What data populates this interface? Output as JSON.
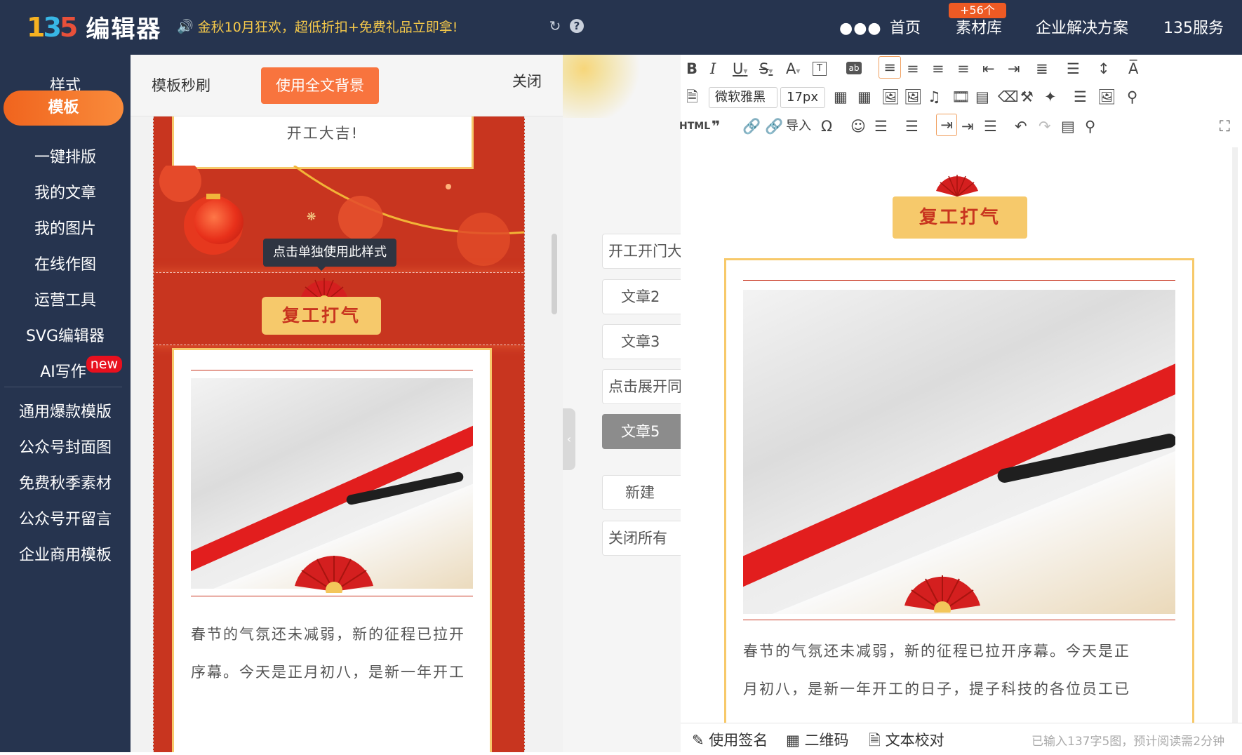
{
  "topbar": {
    "logo_mark": "135",
    "logo_text": "编辑器",
    "promo": "金秋10月狂欢，超低折扣+免费礼品立即拿!",
    "icons": [
      "refresh-icon",
      "help-icon",
      "more-icon"
    ],
    "nav": [
      "首页",
      "素材库",
      "企业解决方案",
      "135服务"
    ],
    "material_badge": "+56个"
  },
  "sidebar": {
    "items": [
      "样式",
      "模板",
      "一键排版",
      "我的文章",
      "我的图片",
      "在线作图",
      "运营工具",
      "SVG编辑器",
      "AI写作"
    ],
    "new_badge": "new",
    "active": "模板",
    "sub_items": [
      "通用爆款模版",
      "公众号封面图",
      "免费秋季素材",
      "公众号开留言",
      "企业商用模板"
    ]
  },
  "template_panel": {
    "title": "模板秒刷",
    "use_bg_button": "使用全文背景",
    "close": "关闭",
    "greeting": "开工大吉!",
    "tooltip": "点击单独使用此样式",
    "banner_title": "复工打气",
    "body_text_line1": "春节的气氛还未减弱，新的征程已拉开",
    "body_text_line2": "序幕。今天是正月初八，是新一年开工"
  },
  "middle": {
    "articles": [
      "开工开门大",
      "文章2",
      "文章3",
      "点击展开同",
      "文章5"
    ],
    "active_article": "文章5",
    "new_button": "新建",
    "close_all_button": "关闭所有"
  },
  "editor": {
    "font_family": "微软雅黑",
    "font_size": "17px",
    "html_label": "HTML",
    "import_label": "导入",
    "banner_title": "复工打气",
    "body_line1": "春节的气氛还未减弱，新的征程已拉开序幕。今天是正",
    "body_line2": "月初八，是新一年开工的日子，提子科技的各位员工已"
  },
  "bottombar": {
    "signature": "使用签名",
    "qrcode": "二维码",
    "proofread": "文本校对",
    "stats": "已输入137字5图，预计阅读需2分钟"
  },
  "colors": {
    "topbar_bg": "#26344f",
    "accent_orange": "#f8743e",
    "festival_red": "#c8351f",
    "gold": "#f7c96a"
  }
}
